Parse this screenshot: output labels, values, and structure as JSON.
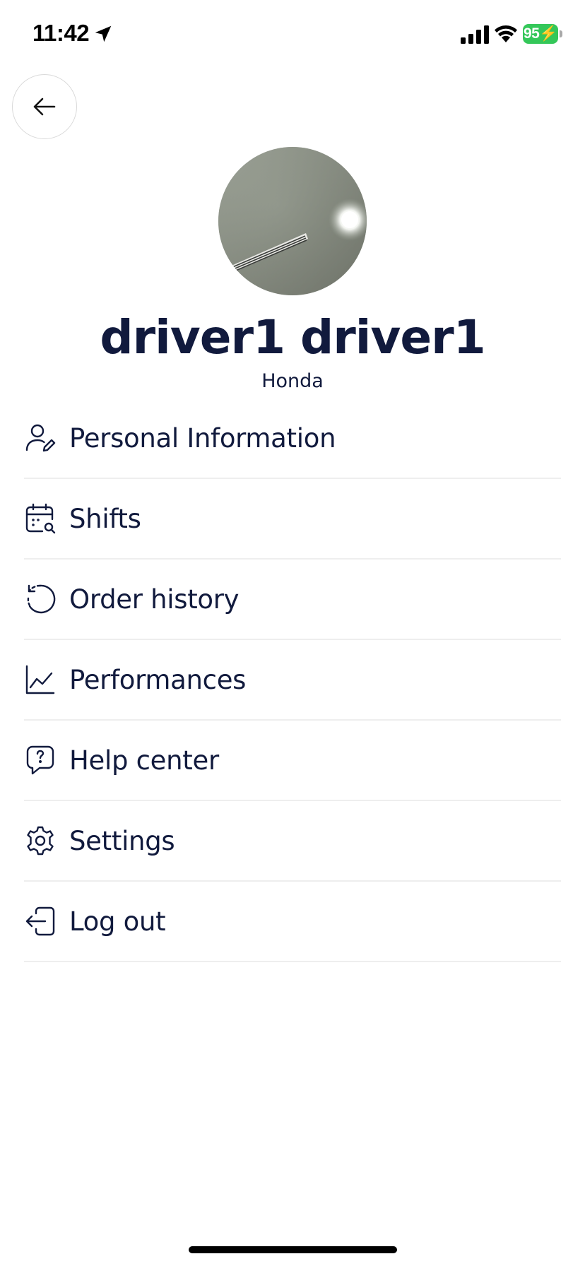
{
  "status_bar": {
    "time": "11:42",
    "battery_level": "95",
    "icons": [
      "location-arrow-icon",
      "cellular-signal-icon",
      "wifi-icon",
      "battery-icon"
    ],
    "battery_color": "#34c759"
  },
  "header": {
    "back_icon": "arrow-left-icon"
  },
  "profile": {
    "name": "driver1 driver1",
    "vehicle": "Honda"
  },
  "menu": {
    "items": [
      {
        "label": "Personal Information",
        "icon": "user-edit-icon"
      },
      {
        "label": "Shifts",
        "icon": "calendar-search-icon"
      },
      {
        "label": "Order history",
        "icon": "history-icon"
      },
      {
        "label": "Performances",
        "icon": "chart-line-icon"
      },
      {
        "label": "Help center",
        "icon": "help-chat-icon"
      },
      {
        "label": "Settings",
        "icon": "gear-icon"
      },
      {
        "label": "Log out",
        "icon": "logout-icon"
      }
    ]
  },
  "theme": {
    "text_color": "#111a3d",
    "divider_color": "#eeeeee",
    "background": "#ffffff"
  }
}
